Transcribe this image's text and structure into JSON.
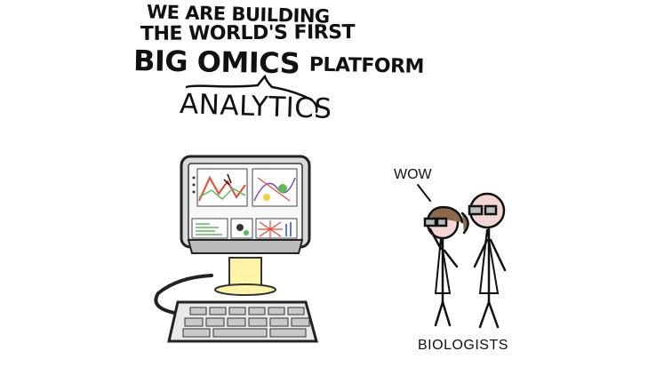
{
  "headline": {
    "line1": "WE ARE BUILDING",
    "line2": "THE WORLD'S FIRST",
    "line3_big": "BIG OMICS",
    "line3_small": "PLATFORM"
  },
  "annotation": "ANALYTICS",
  "speech": "WOW",
  "caption": "BIOLOGISTS",
  "colors": {
    "ink": "#111111",
    "screen_glow": "#fff4a8",
    "chart_red": "#e8483a",
    "chart_green": "#5fb85a",
    "chart_yellow": "#f2d13c"
  }
}
